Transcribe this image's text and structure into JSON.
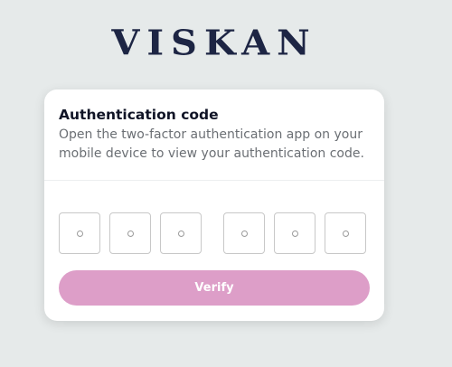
{
  "brand": {
    "logo_text": "VISKAN"
  },
  "auth": {
    "title": "Authentication code",
    "description": "Open the two-factor authentication app on your mobile device to view your authentication code.",
    "digits": [
      "",
      "",
      "",
      "",
      "",
      ""
    ],
    "verify_label": "Verify"
  },
  "colors": {
    "background": "#e6eaea",
    "brand_navy": "#1d2544",
    "button_pink": "#dd9ec8"
  }
}
